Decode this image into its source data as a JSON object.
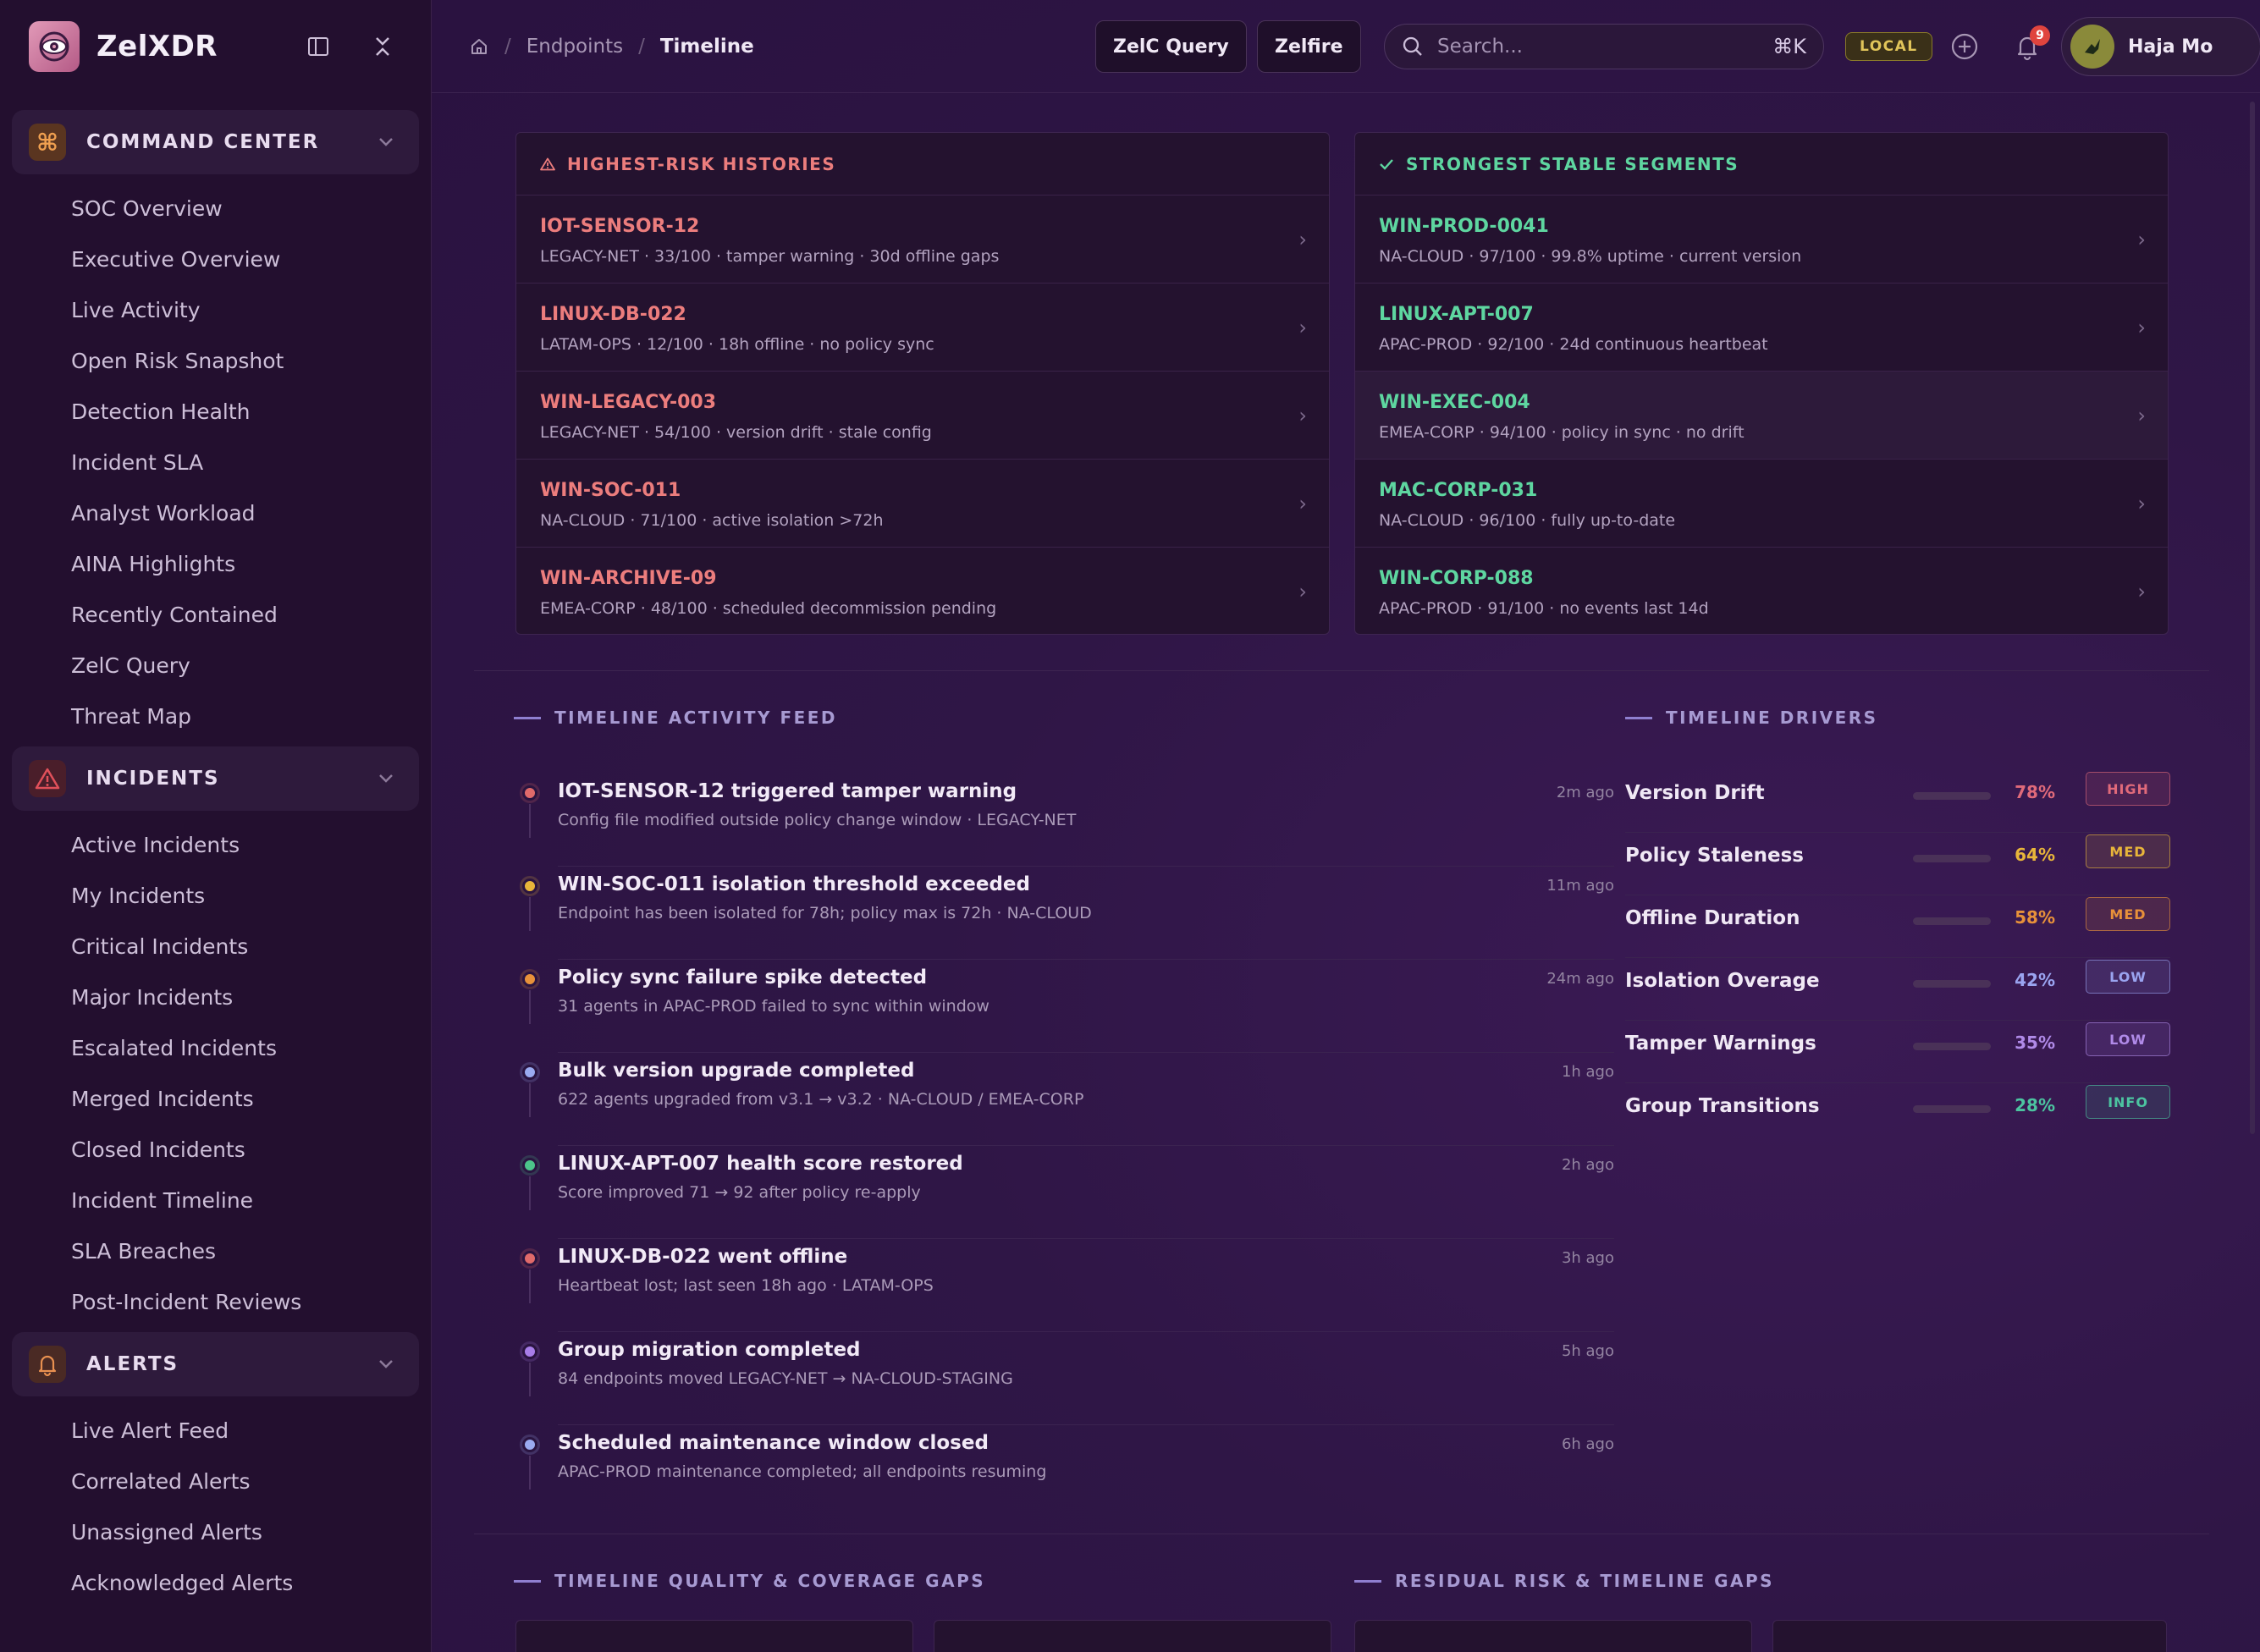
{
  "brand": {
    "name": "ZelXDR"
  },
  "sidebar": {
    "sections": [
      {
        "title": "COMMAND CENTER",
        "items": [
          "SOC Overview",
          "Executive Overview",
          "Live Activity",
          "Open Risk Snapshot",
          "Detection Health",
          "Incident SLA",
          "Analyst Workload",
          "AINA Highlights",
          "Recently Contained",
          "ZelC Query",
          "Threat Map"
        ]
      },
      {
        "title": "INCIDENTS",
        "items": [
          "Active Incidents",
          "My Incidents",
          "Critical Incidents",
          "Major Incidents",
          "Escalated Incidents",
          "Merged Incidents",
          "Closed Incidents",
          "Incident Timeline",
          "SLA Breaches",
          "Post-Incident Reviews"
        ]
      },
      {
        "title": "ALERTS",
        "items": [
          "Live Alert Feed",
          "Correlated Alerts",
          "Unassigned Alerts",
          "Acknowledged Alerts"
        ]
      }
    ]
  },
  "topbar": {
    "breadcrumb": [
      "Endpoints",
      "Timeline"
    ],
    "zelc_query": "ZelC Query",
    "zelfire": "Zelfire",
    "search_placeholder": "Search...",
    "search_shortcut": "⌘K",
    "env_badge": "LOCAL",
    "notification_count": "9",
    "user_name": "Haja Mo"
  },
  "risk_panel": {
    "title": "HIGHEST-RISK HISTORIES",
    "rows": [
      {
        "host": "IOT-SENSOR-12",
        "meta": "LEGACY-NET · 33/100 · tamper warning · 30d offline gaps"
      },
      {
        "host": "LINUX-DB-022",
        "meta": "LATAM-OPS · 12/100 · 18h offline · no policy sync"
      },
      {
        "host": "WIN-LEGACY-003",
        "meta": "LEGACY-NET · 54/100 · version drift · stale config"
      },
      {
        "host": "WIN-SOC-011",
        "meta": "NA-CLOUD · 71/100 · active isolation >72h"
      },
      {
        "host": "WIN-ARCHIVE-09",
        "meta": "EMEA-CORP · 48/100 · scheduled decommission pending"
      }
    ]
  },
  "stable_panel": {
    "title": "STRONGEST STABLE SEGMENTS",
    "rows": [
      {
        "host": "WIN-PROD-0041",
        "meta": "NA-CLOUD · 97/100 · 99.8% uptime · current version"
      },
      {
        "host": "LINUX-APT-007",
        "meta": "APAC-PROD · 92/100 · 24d continuous heartbeat"
      },
      {
        "host": "WIN-EXEC-004",
        "meta": "EMEA-CORP · 94/100 · policy in sync · no drift"
      },
      {
        "host": "MAC-CORP-031",
        "meta": "NA-CLOUD · 96/100 · fully up-to-date"
      },
      {
        "host": "WIN-CORP-088",
        "meta": "APAC-PROD · 91/100 · no events last 14d"
      }
    ]
  },
  "feed": {
    "title": "TIMELINE ACTIVITY FEED",
    "items": [
      {
        "title": "IOT-SENSOR-12 triggered tamper warning",
        "sub": "Config file modified outside policy change window · LEGACY-NET",
        "time": "2m ago",
        "color": "#e06a6a"
      },
      {
        "title": "WIN-SOC-011 isolation threshold exceeded",
        "sub": "Endpoint has been isolated for 78h; policy max is 72h · NA-CLOUD",
        "time": "11m ago",
        "color": "#e8b53a"
      },
      {
        "title": "Policy sync failure spike detected",
        "sub": "31 agents in APAC-PROD failed to sync within window",
        "time": "24m ago",
        "color": "#e8913a"
      },
      {
        "title": "Bulk version upgrade completed",
        "sub": "622 agents upgraded from v3.1 → v3.2 · NA-CLOUD / EMEA-CORP",
        "time": "1h ago",
        "color": "#9aaaf0"
      },
      {
        "title": "LINUX-APT-007 health score restored",
        "sub": "Score improved 71 → 92 after policy re-apply",
        "time": "2h ago",
        "color": "#4cc48a"
      },
      {
        "title": "LINUX-DB-022 went offline",
        "sub": "Heartbeat lost; last seen 18h ago · LATAM-OPS",
        "time": "3h ago",
        "color": "#e06a6a"
      },
      {
        "title": "Group migration completed",
        "sub": "84 endpoints moved LEGACY-NET → NA-CLOUD-STAGING",
        "time": "5h ago",
        "color": "#a77de8"
      },
      {
        "title": "Scheduled maintenance window closed",
        "sub": "APAC-PROD maintenance completed; all endpoints resuming",
        "time": "6h ago",
        "color": "#9aaaf0"
      }
    ]
  },
  "drivers": {
    "title": "TIMELINE DRIVERS",
    "items": [
      {
        "name": "Version Drift",
        "pct": "78%",
        "value": 0.78,
        "level": "HIGH",
        "color": "#e06a7a",
        "fill": "#d9708a"
      },
      {
        "name": "Policy Staleness",
        "pct": "64%",
        "value": 0.64,
        "level": "MED",
        "color": "#e8b53a",
        "fill": "#e0b04a"
      },
      {
        "name": "Offline Duration",
        "pct": "58%",
        "value": 0.58,
        "level": "MED",
        "color": "#e8913a",
        "fill": "#e0905a"
      },
      {
        "name": "Isolation Overage",
        "pct": "42%",
        "value": 0.42,
        "level": "LOW",
        "color": "#9aa4f0",
        "fill": "#9aa4f0"
      },
      {
        "name": "Tamper Warnings",
        "pct": "35%",
        "value": 0.35,
        "level": "LOW",
        "color": "#b08ae8",
        "fill": "#b08ae8"
      },
      {
        "name": "Group Transitions",
        "pct": "28%",
        "value": 0.28,
        "level": "INFO",
        "color": "#4cc4a0",
        "fill": "#4cc48a"
      }
    ]
  },
  "bottom_sections": {
    "left_title": "TIMELINE QUALITY & COVERAGE GAPS",
    "right_title": "RESIDUAL RISK & TIMELINE GAPS"
  }
}
